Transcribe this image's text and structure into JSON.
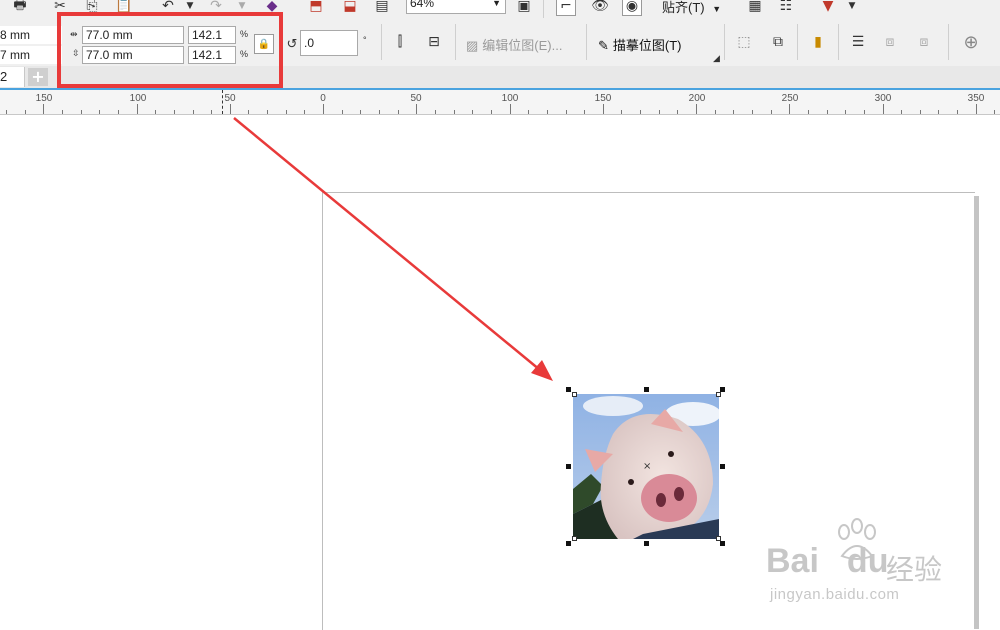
{
  "toolbar1": {
    "zoom_value": "64%",
    "snap_label": "贴齐(T)"
  },
  "property_bar": {
    "x_value": "8 mm",
    "y_value": "7 mm",
    "width_value": "77.0 mm",
    "height_value": "77.0 mm",
    "scale_x_value": "142.1",
    "scale_y_value": "142.1",
    "percent_symbol": "%",
    "rotation_value": ".0",
    "degree_symbol": "°",
    "edit_bitmap_label": "编辑位图(E)...",
    "trace_bitmap_label": "描摹位图(T)"
  },
  "tabs": {
    "doc_tab_label": "2",
    "add_tab_label": "+"
  },
  "ruler": {
    "labels": [
      "150",
      "100",
      "50",
      "0",
      "50",
      "100",
      "150",
      "200",
      "250",
      "300",
      "350"
    ]
  },
  "watermark": {
    "brand": "Bai",
    "brand2": "du",
    "cn": "经验",
    "url": "jingyan.baidu.com"
  },
  "colors": {
    "highlight": "#e83a3a",
    "arrow": "#e83a3a",
    "ruler_accent": "#4aa3df"
  }
}
